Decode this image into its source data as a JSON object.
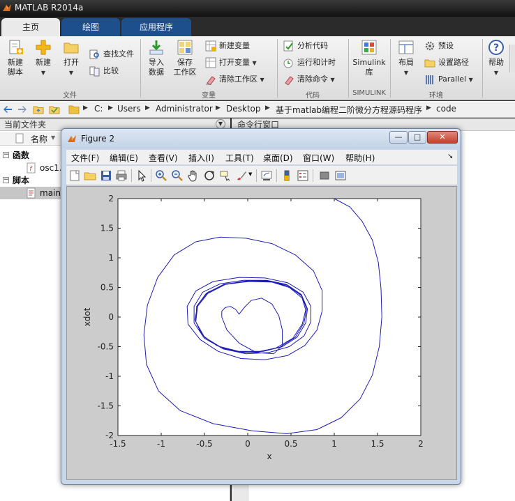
{
  "app": {
    "title": "MATLAB R2014a"
  },
  "tabs": [
    {
      "label": "主页",
      "active": true
    },
    {
      "label": "绘图",
      "active": false
    },
    {
      "label": "应用程序",
      "active": false
    }
  ],
  "ribbon": {
    "file": {
      "section_label": "文件",
      "new_script": [
        "新建",
        "脚本"
      ],
      "new": "新建",
      "open": "打开",
      "find_files": "查找文件",
      "compare": "比较"
    },
    "variable": {
      "section_label": "变量",
      "import": [
        "导入",
        "数据"
      ],
      "save_ws": [
        "保存",
        "工作区"
      ],
      "new_var": "新建变量",
      "open_var": "打开变量",
      "clear_ws": "清除工作区"
    },
    "code": {
      "section_label": "代码",
      "analyze": "分析代码",
      "run_time": "运行和计时",
      "clear_cmd": "清除命令"
    },
    "simulink": {
      "section_label": "SIMULINK",
      "lib": [
        "Simulink",
        "库"
      ]
    },
    "env": {
      "section_label": "环境",
      "layout": "布局",
      "prefs": "预设",
      "set_path": "设置路径",
      "parallel": "Parallel"
    },
    "resources": {
      "help": "帮助"
    }
  },
  "address": {
    "crumbs": [
      "C:",
      "Users",
      "Administrator",
      "Desktop",
      "基于matlab编程二阶微分方程源码程序",
      "code"
    ]
  },
  "left_pane": {
    "title": "当前文件夹",
    "column_name": "名称",
    "groups": [
      {
        "label": "函数",
        "items": [
          "osc1..."
        ]
      },
      {
        "label": "脚本",
        "items": [
          "main"
        ]
      }
    ]
  },
  "command_window": {
    "title": "命令行窗口"
  },
  "figure": {
    "title": "Figure 2",
    "menus": [
      "文件(F)",
      "编辑(E)",
      "查看(V)",
      "插入(I)",
      "工具(T)",
      "桌面(D)",
      "窗口(W)",
      "帮助(H)"
    ],
    "window_buttons": {
      "minimize": "—",
      "maximize": "□",
      "close": "✕"
    }
  },
  "chart_data": {
    "type": "line",
    "title": "",
    "xlabel": "x",
    "ylabel": "xdot",
    "xlim": [
      -1.5,
      2
    ],
    "ylim": [
      -2,
      2
    ],
    "xticks": [
      -1.5,
      -1,
      -0.5,
      0,
      0.5,
      1,
      1.5,
      2
    ],
    "yticks": [
      -2,
      -1.5,
      -1,
      -0.5,
      0,
      0.5,
      1,
      1.5,
      2
    ],
    "grid": false,
    "series": [
      {
        "color": "#1c1cb4",
        "points": [
          [
            1.0,
            2.0
          ],
          [
            1.18,
            1.86
          ],
          [
            1.32,
            1.62
          ],
          [
            1.44,
            1.3
          ],
          [
            1.51,
            0.92
          ],
          [
            1.54,
            0.48
          ],
          [
            1.55,
            0.0
          ],
          [
            1.52,
            -0.5
          ],
          [
            1.44,
            -0.98
          ],
          [
            1.3,
            -1.38
          ],
          [
            1.08,
            -1.7
          ],
          [
            0.8,
            -1.9
          ],
          [
            0.45,
            -1.97
          ],
          [
            0.05,
            -1.92
          ],
          [
            -0.4,
            -1.8
          ],
          [
            -0.78,
            -1.58
          ],
          [
            -1.03,
            -1.25
          ],
          [
            -1.17,
            -0.8
          ],
          [
            -1.2,
            -0.3
          ],
          [
            -1.16,
            0.2
          ],
          [
            -1.04,
            0.67
          ],
          [
            -0.85,
            1.05
          ],
          [
            -0.6,
            1.27
          ],
          [
            -0.32,
            1.35
          ],
          [
            -0.02,
            1.33
          ],
          [
            0.28,
            1.24
          ],
          [
            0.55,
            1.05
          ],
          [
            0.76,
            0.78
          ],
          [
            0.86,
            0.45
          ],
          [
            0.86,
            0.1
          ],
          [
            0.8,
            -0.22
          ],
          [
            0.66,
            -0.48
          ],
          [
            0.46,
            -0.65
          ],
          [
            0.2,
            -0.72
          ],
          [
            -0.08,
            -0.7
          ],
          [
            -0.34,
            -0.58
          ],
          [
            -0.55,
            -0.38
          ],
          [
            -0.69,
            -0.12
          ],
          [
            -0.7,
            0.18
          ],
          [
            -0.6,
            0.44
          ],
          [
            -0.4,
            0.6
          ],
          [
            -0.1,
            0.67
          ],
          [
            0.2,
            0.66
          ],
          [
            0.46,
            0.58
          ],
          [
            0.64,
            0.42
          ],
          [
            0.73,
            0.18
          ],
          [
            0.73,
            -0.08
          ],
          [
            0.65,
            -0.32
          ],
          [
            0.48,
            -0.5
          ],
          [
            0.24,
            -0.6
          ],
          [
            -0.02,
            -0.62
          ],
          [
            -0.28,
            -0.54
          ],
          [
            -0.5,
            -0.36
          ],
          [
            -0.62,
            -0.1
          ],
          [
            -0.62,
            0.18
          ],
          [
            -0.52,
            0.42
          ],
          [
            -0.32,
            0.56
          ],
          [
            -0.05,
            0.62
          ],
          [
            0.22,
            0.62
          ],
          [
            0.45,
            0.55
          ],
          [
            0.62,
            0.38
          ],
          [
            0.69,
            0.14
          ],
          [
            0.67,
            -0.1
          ],
          [
            0.57,
            -0.34
          ],
          [
            0.4,
            -0.5
          ],
          [
            0.18,
            -0.58
          ],
          [
            -0.07,
            -0.6
          ],
          [
            -0.3,
            -0.52
          ],
          [
            -0.5,
            -0.34
          ],
          [
            -0.6,
            -0.08
          ],
          [
            -0.59,
            0.18
          ],
          [
            -0.48,
            0.4
          ],
          [
            -0.28,
            0.55
          ],
          [
            -0.02,
            0.61
          ],
          [
            0.24,
            0.61
          ],
          [
            0.46,
            0.54
          ],
          [
            0.62,
            0.37
          ],
          [
            0.68,
            0.14
          ],
          [
            0.65,
            -0.1
          ],
          [
            0.55,
            -0.34
          ],
          [
            0.37,
            -0.51
          ],
          [
            0.14,
            -0.58
          ],
          [
            -0.1,
            -0.58
          ],
          [
            -0.32,
            -0.5
          ],
          [
            -0.51,
            -0.33
          ],
          [
            -0.6,
            -0.08
          ],
          [
            -0.58,
            0.18
          ],
          [
            -0.46,
            0.4
          ],
          [
            -0.26,
            0.55
          ],
          [
            0.0,
            0.6
          ],
          [
            0.26,
            0.6
          ],
          [
            0.47,
            0.52
          ],
          [
            0.62,
            0.36
          ],
          [
            0.67,
            0.12
          ],
          [
            0.63,
            -0.12
          ],
          [
            0.52,
            -0.36
          ],
          [
            0.33,
            -0.52
          ],
          [
            0.1,
            -0.6
          ],
          [
            -0.14,
            -0.58
          ],
          [
            -0.36,
            -0.48
          ],
          [
            -0.53,
            -0.3
          ],
          [
            -0.61,
            -0.05
          ],
          [
            -0.58,
            0.2
          ],
          [
            -0.46,
            0.42
          ],
          [
            -0.25,
            0.56
          ],
          [
            0.02,
            0.6
          ],
          [
            0.28,
            0.59
          ],
          [
            0.48,
            0.5
          ],
          [
            0.62,
            0.33
          ]
        ]
      },
      {
        "color": "#1c1cb4",
        "points": [
          [
            -0.3,
            0.1
          ],
          [
            -0.26,
            0.16
          ],
          [
            -0.2,
            0.18
          ],
          [
            -0.14,
            0.13
          ],
          [
            -0.1,
            0.05
          ],
          [
            -0.04,
            0.16
          ],
          [
            0.04,
            0.28
          ],
          [
            0.16,
            0.32
          ],
          [
            0.28,
            0.22
          ],
          [
            0.36,
            0.02
          ],
          [
            0.4,
            -0.22
          ],
          [
            0.4,
            -0.48
          ],
          [
            0.3,
            -0.62
          ],
          [
            0.1,
            -0.6
          ],
          [
            -0.1,
            -0.44
          ],
          [
            -0.24,
            -0.22
          ],
          [
            -0.3,
            0.0
          ],
          [
            -0.3,
            0.1
          ]
        ]
      }
    ]
  }
}
